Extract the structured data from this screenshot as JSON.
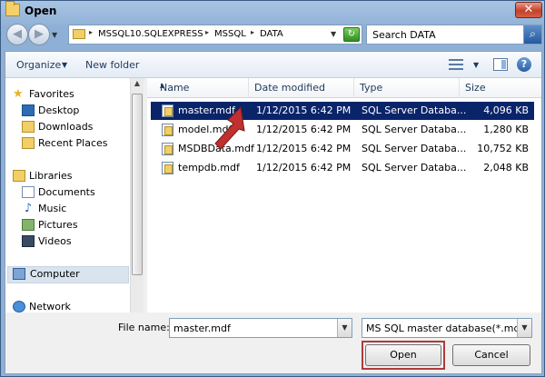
{
  "window": {
    "title": "Open",
    "close_glyph": "✕"
  },
  "nav": {
    "back_glyph": "◀",
    "forward_glyph": "▶",
    "recent_glyph": "▼",
    "breadcrumb": [
      "MSSQL10.SQLEXPRESS",
      "MSSQL",
      "DATA"
    ],
    "crumb_glyph": "▸",
    "address_drop_glyph": "▼",
    "refresh_glyph": "↻"
  },
  "search": {
    "placeholder": "Search DATA",
    "button_glyph": "⌕"
  },
  "toolbar": {
    "organize_label": "Organize",
    "organize_arrow": "▼",
    "new_folder_label": "New folder",
    "views_arrow": "▼",
    "help_glyph": "?"
  },
  "sidebar": {
    "star_glyph": "★",
    "music_glyph": "♪",
    "scroll_up_glyph": "▲",
    "items": [
      {
        "label": "Favorites"
      },
      {
        "label": "Desktop"
      },
      {
        "label": "Downloads"
      },
      {
        "label": "Recent Places"
      },
      {
        "label": "Libraries"
      },
      {
        "label": "Documents"
      },
      {
        "label": "Music"
      },
      {
        "label": "Pictures"
      },
      {
        "label": "Videos"
      },
      {
        "label": "Computer"
      },
      {
        "label": "Network"
      }
    ]
  },
  "columns": {
    "name": "Name",
    "sort_glyph": "▲",
    "date": "Date modified",
    "type": "Type",
    "size": "Size"
  },
  "files": [
    {
      "name": "master.mdf",
      "date": "1/12/2015 6:42 PM",
      "type": "SQL Server Databa...",
      "size": "4,096 KB"
    },
    {
      "name": "model.mdf",
      "date": "1/12/2015 6:42 PM",
      "type": "SQL Server Databa...",
      "size": "1,280 KB"
    },
    {
      "name": "MSDBData.mdf",
      "date": "1/12/2015 6:42 PM",
      "type": "SQL Server Databa...",
      "size": "10,752 KB"
    },
    {
      "name": "tempdb.mdf",
      "date": "1/12/2015 6:42 PM",
      "type": "SQL Server Databa...",
      "size": "2,048 KB"
    }
  ],
  "footer": {
    "file_name_label": "File name:",
    "file_name_value": "master.mdf",
    "drop_glyph": "▼",
    "file_type": "MS SQL master database(*.mdf",
    "open_label": "Open",
    "cancel_label": "Cancel"
  },
  "colors": {
    "selection": "#0a246a",
    "highlight_border": "#b03a3a",
    "annotation_arrow": "#c0302e"
  }
}
